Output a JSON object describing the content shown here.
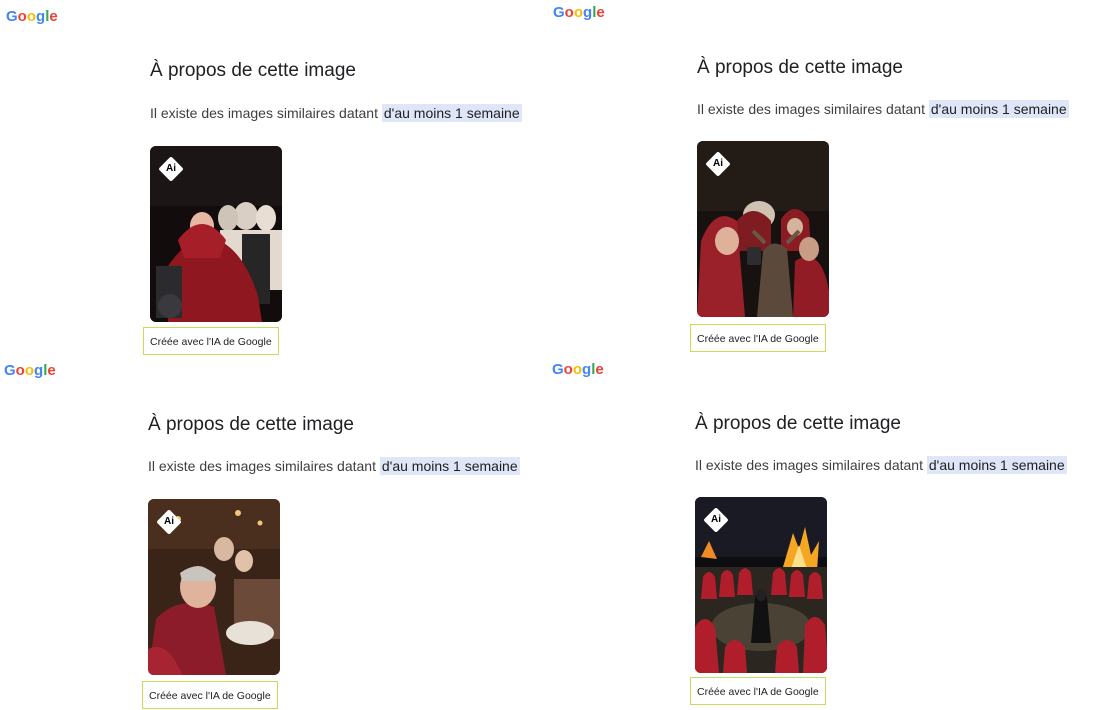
{
  "logo": {
    "letters": [
      {
        "char": "G",
        "color": "#4285F4"
      },
      {
        "char": "o",
        "color": "#EA4335"
      },
      {
        "char": "o",
        "color": "#FBBC05"
      },
      {
        "char": "g",
        "color": "#4285F4"
      },
      {
        "char": "l",
        "color": "#34A853"
      },
      {
        "char": "e",
        "color": "#EA4335"
      }
    ]
  },
  "panels": [
    {
      "title": "À propos de cette image",
      "subtitle_prefix": "Il existe des images similaires datant ",
      "subtitle_highlight": "d'au moins 1 semaine",
      "badge": "Ai",
      "caption": "Créée avec l'IA de Google"
    },
    {
      "title": "À propos de cette image",
      "subtitle_prefix": "Il existe des images similaires datant ",
      "subtitle_highlight": "d'au moins 1 semaine",
      "badge": "Ai",
      "caption": "Créée avec l'IA de Google"
    },
    {
      "title": "À propos de cette image",
      "subtitle_prefix": "Il existe des images similaires datant ",
      "subtitle_highlight": "d'au moins 1 semaine",
      "badge": "Ai",
      "caption": "Créée avec l'IA de Google"
    },
    {
      "title": "À propos de cette image",
      "subtitle_prefix": "Il existe des images similaires datant ",
      "subtitle_highlight": "d'au moins 1 semaine",
      "badge": "Ai",
      "caption": "Créée avec l'IA de Google"
    }
  ],
  "colors": {
    "highlight": "#dfe6f8",
    "caption_border": "#c6dc5c"
  }
}
